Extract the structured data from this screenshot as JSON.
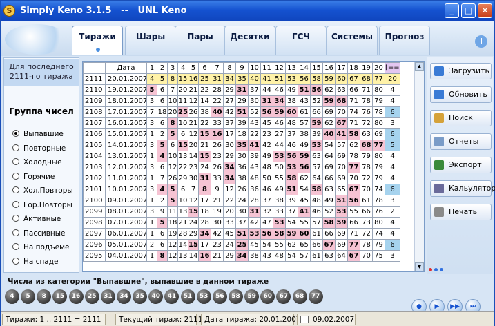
{
  "window": {
    "title": "Simply Keno 3.1.5   --   UNL Keno",
    "icon_letter": "S"
  },
  "tabs": [
    "Тиражи",
    "Шары",
    "Пары",
    "Десятки",
    "ГСЧ",
    "Системы",
    "Прогноз"
  ],
  "active_tab": 0,
  "left_panel": {
    "draw_info_line1": "Для последнего",
    "draw_info_line2": "2111-го тиража",
    "group_header": "Группа чисел",
    "options": [
      "Выпавшие",
      "Повторные",
      "Холодные",
      "Горячие",
      "Хол.Повторы",
      "Гор.Повторы",
      "Активные",
      "Пассивные",
      "На подъеме",
      "На спаде"
    ],
    "selected_option": 0
  },
  "grid": {
    "header": [
      "",
      "Дата",
      "1",
      "2",
      "3",
      "4",
      "5",
      "6",
      "7",
      "8",
      "9",
      "10",
      "11",
      "12",
      "13",
      "14",
      "15",
      "16",
      "17",
      "18",
      "19",
      "20",
      "[==]"
    ],
    "rows": [
      {
        "num": "2111",
        "date": "20.01.2007",
        "cells": [
          "4",
          "5",
          "8",
          "15",
          "16",
          "25",
          "31",
          "34",
          "35",
          "40",
          "41",
          "51",
          "53",
          "56",
          "58",
          "59",
          "60",
          "67",
          "68",
          "77",
          "20"
        ]
      },
      {
        "num": "2110",
        "date": "19.01.2007",
        "cells": [
          "5",
          "6",
          "7",
          "20",
          "21",
          "22",
          "28",
          "29",
          "31",
          "37",
          "44",
          "46",
          "49",
          "51",
          "56",
          "62",
          "63",
          "66",
          "71",
          "80",
          "4"
        ]
      },
      {
        "num": "2109",
        "date": "18.01.2007",
        "cells": [
          "3",
          "6",
          "10",
          "11",
          "12",
          "14",
          "22",
          "27",
          "29",
          "30",
          "31",
          "34",
          "38",
          "43",
          "52",
          "59",
          "68",
          "71",
          "78",
          "79",
          "4"
        ]
      },
      {
        "num": "2108",
        "date": "17.01.2007",
        "cells": [
          "7",
          "18",
          "20",
          "25",
          "26",
          "38",
          "40",
          "42",
          "51",
          "52",
          "56",
          "59",
          "60",
          "61",
          "66",
          "69",
          "70",
          "74",
          "76",
          "78",
          "6"
        ]
      },
      {
        "num": "2107",
        "date": "16.01.2007",
        "cells": [
          "3",
          "6",
          "8",
          "10",
          "21",
          "22",
          "33",
          "37",
          "39",
          "43",
          "45",
          "46",
          "48",
          "57",
          "59",
          "62",
          "67",
          "71",
          "72",
          "80",
          "3"
        ]
      },
      {
        "num": "2106",
        "date": "15.01.2007",
        "cells": [
          "1",
          "2",
          "5",
          "6",
          "12",
          "15",
          "16",
          "17",
          "18",
          "22",
          "23",
          "27",
          "37",
          "38",
          "39",
          "40",
          "41",
          "58",
          "63",
          "69",
          "6"
        ]
      },
      {
        "num": "2105",
        "date": "14.01.2007",
        "cells": [
          "3",
          "5",
          "6",
          "15",
          "20",
          "21",
          "26",
          "30",
          "35",
          "41",
          "42",
          "44",
          "46",
          "49",
          "53",
          "54",
          "57",
          "62",
          "68",
          "77",
          "5"
        ]
      },
      {
        "num": "2104",
        "date": "13.01.2007",
        "cells": [
          "1",
          "4",
          "10",
          "13",
          "14",
          "15",
          "23",
          "29",
          "30",
          "39",
          "49",
          "53",
          "56",
          "59",
          "63",
          "64",
          "69",
          "78",
          "79",
          "80",
          "4"
        ]
      },
      {
        "num": "2103",
        "date": "12.01.2007",
        "cells": [
          "3",
          "6",
          "12",
          "22",
          "23",
          "24",
          "26",
          "34",
          "36",
          "43",
          "48",
          "50",
          "53",
          "56",
          "57",
          "69",
          "70",
          "77",
          "78",
          "79",
          "4"
        ]
      },
      {
        "num": "2102",
        "date": "11.01.2007",
        "cells": [
          "1",
          "7",
          "26",
          "29",
          "30",
          "31",
          "33",
          "34",
          "38",
          "48",
          "50",
          "55",
          "58",
          "62",
          "64",
          "66",
          "69",
          "70",
          "72",
          "79",
          "4"
        ]
      },
      {
        "num": "2101",
        "date": "10.01.2007",
        "cells": [
          "3",
          "4",
          "5",
          "6",
          "7",
          "8",
          "9",
          "12",
          "26",
          "36",
          "46",
          "49",
          "51",
          "54",
          "58",
          "63",
          "65",
          "67",
          "70",
          "74",
          "6"
        ]
      },
      {
        "num": "2100",
        "date": "09.01.2007",
        "cells": [
          "1",
          "2",
          "5",
          "10",
          "12",
          "17",
          "21",
          "22",
          "24",
          "28",
          "37",
          "38",
          "39",
          "45",
          "48",
          "49",
          "51",
          "56",
          "61",
          "78",
          "3"
        ]
      },
      {
        "num": "2099",
        "date": "08.01.2007",
        "cells": [
          "3",
          "9",
          "11",
          "13",
          "15",
          "18",
          "19",
          "20",
          "30",
          "31",
          "32",
          "33",
          "37",
          "41",
          "46",
          "52",
          "53",
          "55",
          "66",
          "76",
          "2"
        ]
      },
      {
        "num": "2098",
        "date": "07.01.2007",
        "cells": [
          "1",
          "5",
          "18",
          "21",
          "24",
          "28",
          "30",
          "33",
          "37",
          "42",
          "47",
          "53",
          "54",
          "55",
          "57",
          "58",
          "59",
          "66",
          "73",
          "80",
          "4"
        ]
      },
      {
        "num": "2097",
        "date": "06.01.2007",
        "cells": [
          "1",
          "6",
          "19",
          "28",
          "29",
          "34",
          "42",
          "45",
          "51",
          "53",
          "56",
          "58",
          "59",
          "60",
          "61",
          "66",
          "69",
          "71",
          "72",
          "74",
          "4"
        ]
      },
      {
        "num": "2096",
        "date": "05.01.2007",
        "cells": [
          "2",
          "6",
          "12",
          "14",
          "15",
          "17",
          "23",
          "24",
          "25",
          "45",
          "54",
          "55",
          "62",
          "65",
          "66",
          "67",
          "69",
          "77",
          "78",
          "79",
          "6"
        ]
      },
      {
        "num": "2095",
        "date": "04.01.2007",
        "cells": [
          "1",
          "8",
          "12",
          "13",
          "14",
          "16",
          "21",
          "29",
          "34",
          "38",
          "43",
          "48",
          "54",
          "57",
          "61",
          "63",
          "64",
          "67",
          "70",
          "75",
          "3"
        ]
      }
    ]
  },
  "right_buttons": [
    "Загрузить",
    "Обновить",
    "Поиск",
    "Отчеты",
    "Экспорт",
    "Кальулятор",
    "Печать"
  ],
  "bottom_label": "Числа из категории \"Выпавшие\", выпавшие в данном тираже",
  "balls": [
    "4",
    "5",
    "8",
    "15",
    "16",
    "25",
    "31",
    "34",
    "35",
    "40",
    "41",
    "51",
    "53",
    "56",
    "58",
    "59",
    "60",
    "67",
    "68",
    "77"
  ],
  "status": {
    "draws": "Тиражи: 1 .. 2111 = 2111",
    "current": "Текущий тираж: 2111",
    "date": "Дата тиража: 20.01.2007",
    "clock": "09.02.2007"
  },
  "colors": {
    "yellow": "#fff2a8",
    "pink": "#f6c3d3",
    "blue": "#a6d3ee",
    "title_bar": "#1552d0"
  }
}
